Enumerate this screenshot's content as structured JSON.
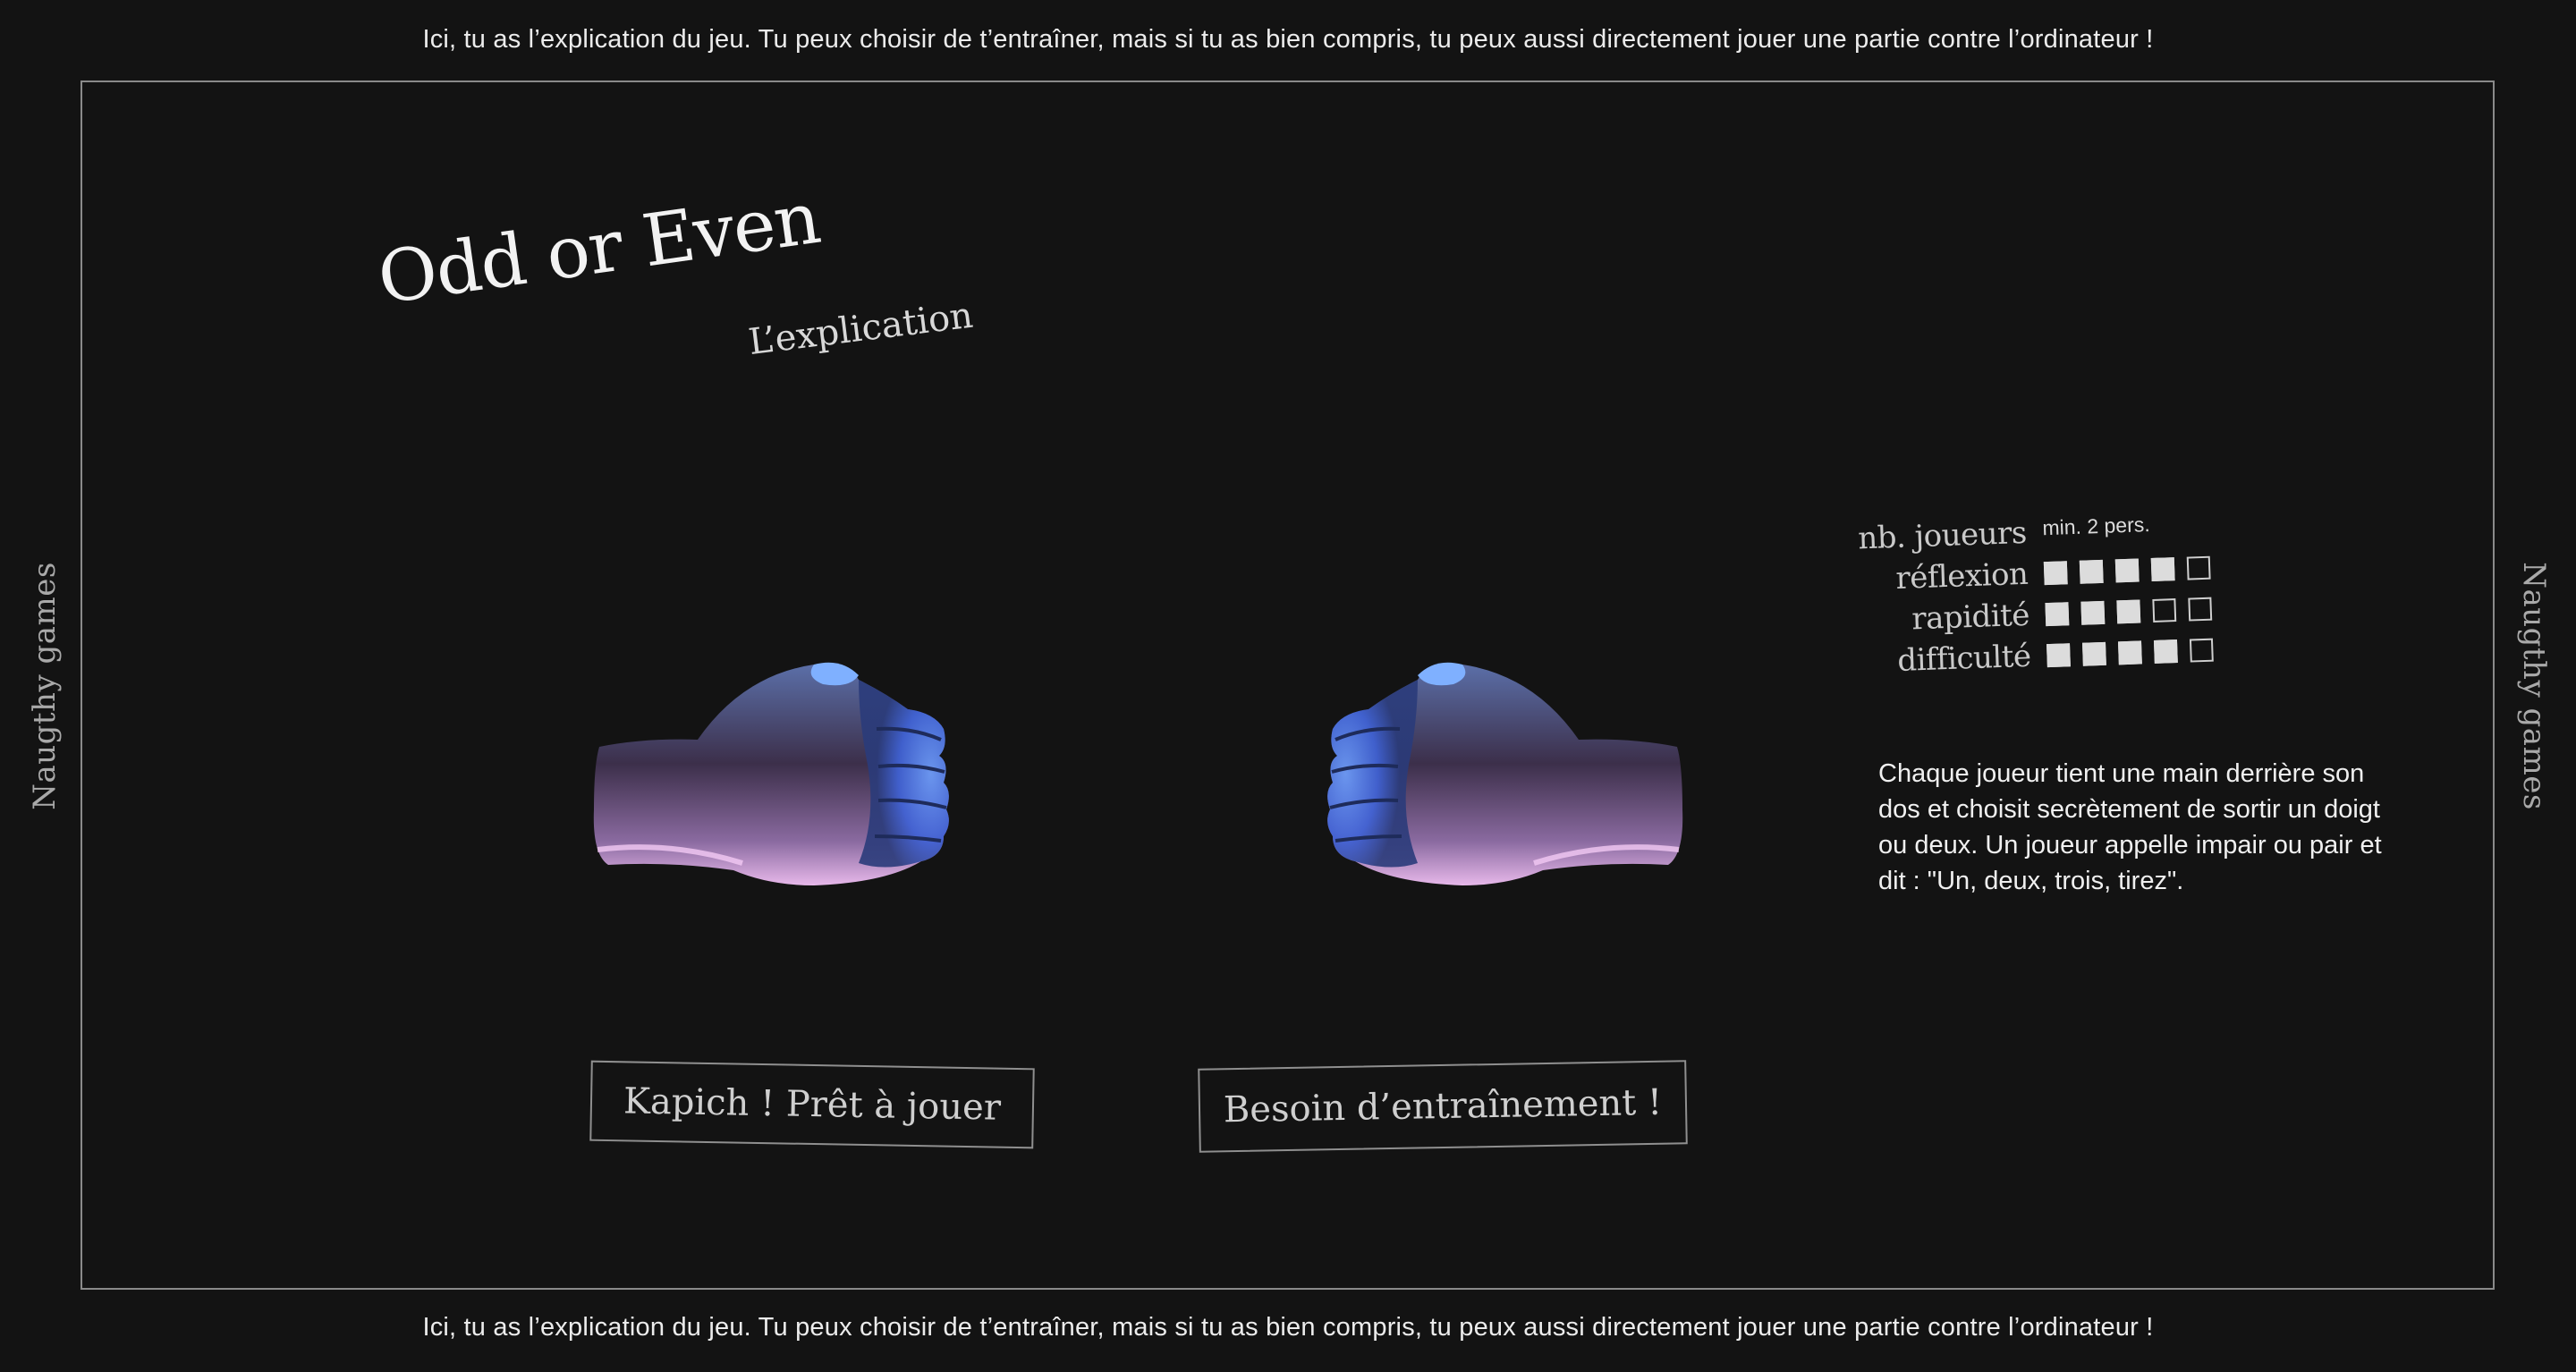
{
  "header": {
    "intro_text": "Ici, tu as l’explication du jeu. Tu peux choisir de t’entraîner, mais si tu as bien compris, tu peux aussi directement jouer une partie contre l’ordinateur !"
  },
  "footer": {
    "intro_text": "Ici, tu as l’explication du jeu. Tu peux choisir de t’entraîner, mais si tu as bien compris, tu peux aussi directement jouer une partie contre l’ordinateur !"
  },
  "side": {
    "left_label": "Naugthy games",
    "right_label": "Naugthy games"
  },
  "game": {
    "title": "Odd or Even",
    "subtitle": "L’explication"
  },
  "stats": {
    "players_label": "nb. joueurs",
    "players_value": "min. 2 pers.",
    "ratings": [
      {
        "label": "réflexion",
        "value": 4,
        "max": 5
      },
      {
        "label": "rapidité",
        "value": 3,
        "max": 5
      },
      {
        "label": "difficulté",
        "value": 4,
        "max": 5
      }
    ]
  },
  "description": "Chaque joueur tient une main derrière son dos et choisit secrètement de sortir un doigt ou deux. Un joueur appelle impair ou pair et dit : \"Un, deux, trois, tirez\".",
  "buttons": {
    "play_label": "Kapich ! Prêt à jouer",
    "train_label": "Besoin d’entraînement !"
  },
  "icons": {
    "left_hand": "fist-hand-icon",
    "right_hand": "fist-hand-icon"
  },
  "colors": {
    "background": "#131313",
    "frame": "#8a8a8a",
    "hand_blue": "#4f7dff",
    "hand_pink": "#e6b6e8"
  }
}
